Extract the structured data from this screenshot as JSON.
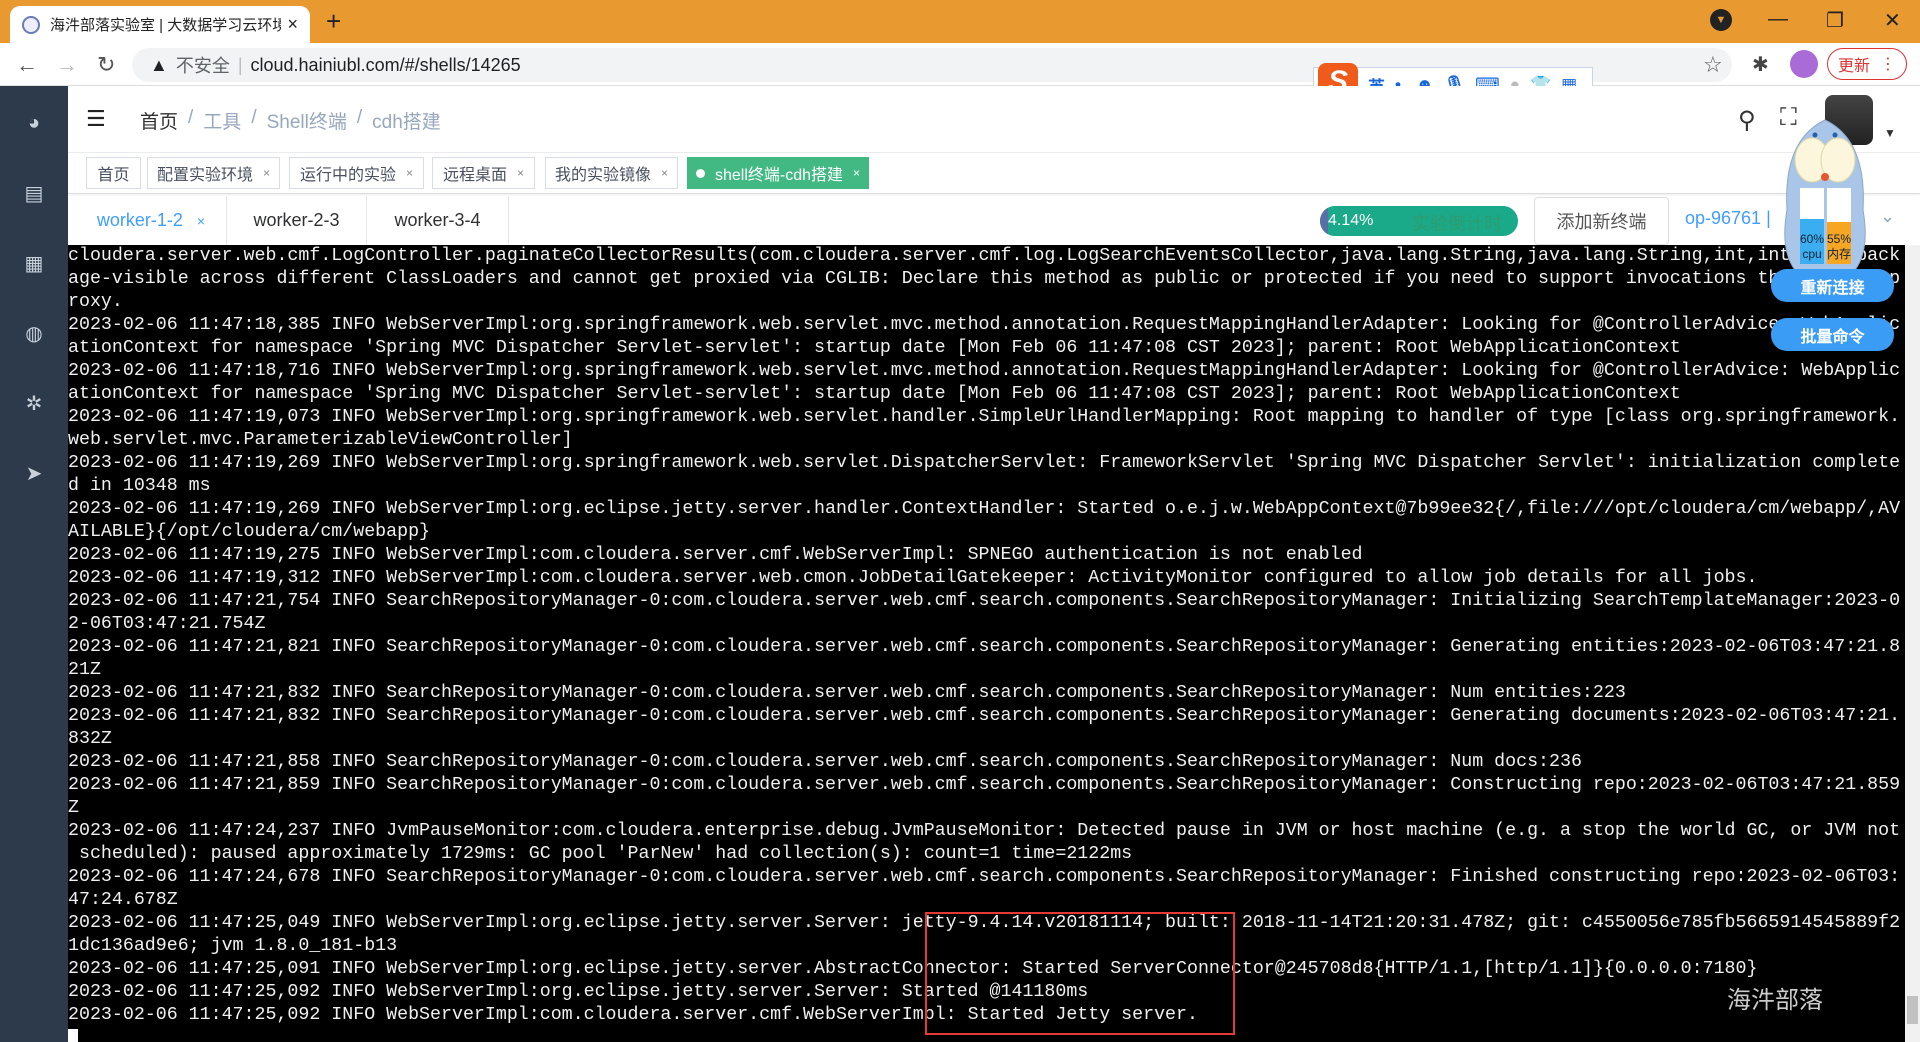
{
  "browser": {
    "tab_title": "海汼部落实验室 | 大数据学习云环境",
    "close_tab": "×",
    "new_tab": "+",
    "insecure_label": "不安全",
    "url": "cloud.hainiubl.com/#/shells/14265",
    "update_label": "更新",
    "ime_label": "英"
  },
  "header": {
    "breadcrumb": [
      "首页",
      "工具",
      "Shell终端",
      "cdh搭建"
    ]
  },
  "tags": [
    {
      "label": "首页",
      "closable": false
    },
    {
      "label": "配置实验环境",
      "closable": true
    },
    {
      "label": "运行中的实验",
      "closable": true
    },
    {
      "label": "远程桌面",
      "closable": true
    },
    {
      "label": "我的实验镜像",
      "closable": true
    },
    {
      "label": "shell终端-cdh搭建",
      "closable": true,
      "active": true
    }
  ],
  "tag_close": "×",
  "worker_tabs": [
    {
      "label": "worker-1-2",
      "active": true,
      "close": "×"
    },
    {
      "label": "worker-2-3"
    },
    {
      "label": "worker-3-4"
    }
  ],
  "countdown": {
    "percent_label": "4.14%",
    "percent": 4.14,
    "label": "实验倒计时"
  },
  "add_terminal": "添加新终端",
  "op_id": "op-96761 |",
  "monitor": {
    "cpu": "60%",
    "cpu_label": "cpu",
    "mem": "55%",
    "mem_label": "内存"
  },
  "float_buttons": {
    "reconnect": "重新连接",
    "batch": "批量命令"
  },
  "watermark": "海汼部落",
  "colors": {
    "tabstrip": "#e8992f",
    "sidebar": "#2d3a4b",
    "active_tag": "#42b983",
    "link": "#409eff",
    "highlight_box": "#e53935"
  },
  "terminal_lines": [
    "cloudera.server.web.cmf.LogController.paginateCollectorResults(com.cloudera.server.cmf.log.LogSearchEventsCollector,java.lang.String,java.lang.String,int,int)] is pack",
    "age-visible across different ClassLoaders and cannot get proxied via CGLIB: Declare this method as public or protected if you need to support invocations through the p",
    "roxy.",
    "2023-02-06 11:47:18,385 INFO WebServerImpl:org.springframework.web.servlet.mvc.method.annotation.RequestMappingHandlerAdapter: Looking for @ControllerAdvice: WebApplic",
    "ationContext for namespace 'Spring MVC Dispatcher Servlet-servlet': startup date [Mon Feb 06 11:47:08 CST 2023]; parent: Root WebApplicationContext",
    "2023-02-06 11:47:18,716 INFO WebServerImpl:org.springframework.web.servlet.mvc.method.annotation.RequestMappingHandlerAdapter: Looking for @ControllerAdvice: WebApplic",
    "ationContext for namespace 'Spring MVC Dispatcher Servlet-servlet': startup date [Mon Feb 06 11:47:08 CST 2023]; parent: Root WebApplicationContext",
    "2023-02-06 11:47:19,073 INFO WebServerImpl:org.springframework.web.servlet.handler.SimpleUrlHandlerMapping: Root mapping to handler of type [class org.springframework.",
    "web.servlet.mvc.ParameterizableViewController]",
    "2023-02-06 11:47:19,269 INFO WebServerImpl:org.springframework.web.servlet.DispatcherServlet: FrameworkServlet 'Spring MVC Dispatcher Servlet': initialization complete",
    "d in 10348 ms",
    "2023-02-06 11:47:19,269 INFO WebServerImpl:org.eclipse.jetty.server.handler.ContextHandler: Started o.e.j.w.WebAppContext@7b99ee32{/,file:///opt/cloudera/cm/webapp/,AV",
    "AILABLE}{/opt/cloudera/cm/webapp}",
    "2023-02-06 11:47:19,275 INFO WebServerImpl:com.cloudera.server.cmf.WebServerImpl: SPNEGO authentication is not enabled",
    "2023-02-06 11:47:19,312 INFO WebServerImpl:com.cloudera.server.web.cmon.JobDetailGatekeeper: ActivityMonitor configured to allow job details for all jobs.",
    "2023-02-06 11:47:21,754 INFO SearchRepositoryManager-0:com.cloudera.server.web.cmf.search.components.SearchRepositoryManager: Initializing SearchTemplateManager:2023-0",
    "2-06T03:47:21.754Z",
    "2023-02-06 11:47:21,821 INFO SearchRepositoryManager-0:com.cloudera.server.web.cmf.search.components.SearchRepositoryManager: Generating entities:2023-02-06T03:47:21.8",
    "21Z",
    "2023-02-06 11:47:21,832 INFO SearchRepositoryManager-0:com.cloudera.server.web.cmf.search.components.SearchRepositoryManager: Num entities:223",
    "2023-02-06 11:47:21,832 INFO SearchRepositoryManager-0:com.cloudera.server.web.cmf.search.components.SearchRepositoryManager: Generating documents:2023-02-06T03:47:21.",
    "832Z",
    "2023-02-06 11:47:21,858 INFO SearchRepositoryManager-0:com.cloudera.server.web.cmf.search.components.SearchRepositoryManager: Num docs:236",
    "2023-02-06 11:47:21,859 INFO SearchRepositoryManager-0:com.cloudera.server.web.cmf.search.components.SearchRepositoryManager: Constructing repo:2023-02-06T03:47:21.859",
    "Z",
    "2023-02-06 11:47:24,237 INFO JvmPauseMonitor:com.cloudera.enterprise.debug.JvmPauseMonitor: Detected pause in JVM or host machine (e.g. a stop the world GC, or JVM not",
    " scheduled): paused approximately 1729ms: GC pool 'ParNew' had collection(s): count=1 time=2122ms",
    "2023-02-06 11:47:24,678 INFO SearchRepositoryManager-0:com.cloudera.server.web.cmf.search.components.SearchRepositoryManager: Finished constructing repo:2023-02-06T03:",
    "47:24.678Z",
    "2023-02-06 11:47:25,049 INFO WebServerImpl:org.eclipse.jetty.server.Server: jetty-9.4.14.v20181114; built: 2018-11-14T21:20:31.478Z; git: c4550056e785fb5665914545889f2",
    "1dc136ad9e6; jvm 1.8.0_181-b13",
    "2023-02-06 11:47:25,091 INFO WebServerImpl:org.eclipse.jetty.server.AbstractConnector: Started ServerConnector@245708d8{HTTP/1.1,[http/1.1]}{0.0.0.0:7180}",
    "2023-02-06 11:47:25,092 INFO WebServerImpl:org.eclipse.jetty.server.Server: Started @141180ms",
    "2023-02-06 11:47:25,092 INFO WebServerImpl:com.cloudera.server.cmf.WebServerImpl: Started Jetty server."
  ]
}
